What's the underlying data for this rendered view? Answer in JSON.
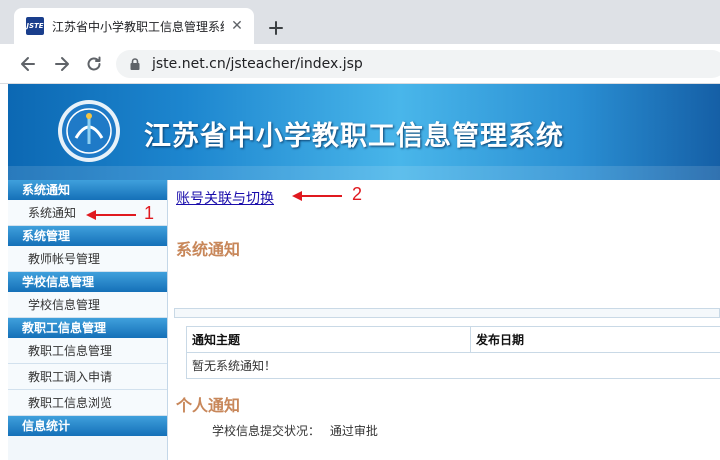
{
  "browser": {
    "tab_title": "江苏省中小学教职工信息管理系统",
    "tab_favicon_text": "JSTE",
    "url": "jste.net.cn/jsteacher/index.jsp"
  },
  "banner": {
    "title": "江苏省中小学教职工信息管理系统"
  },
  "sidebar": {
    "sections": [
      {
        "header": "系统通知",
        "items": [
          "系统通知"
        ]
      },
      {
        "header": "系统管理",
        "items": [
          "教师帐号管理"
        ]
      },
      {
        "header": "学校信息管理",
        "items": [
          "学校信息管理"
        ]
      },
      {
        "header": "教职工信息管理",
        "items": [
          "教职工信息管理",
          "教职工调入申请",
          "教职工信息浏览"
        ]
      },
      {
        "header": "信息统计",
        "items": []
      }
    ]
  },
  "content": {
    "switch_link": "账号关联与切换",
    "system_notice_title": "系统通知",
    "table_headers": [
      "通知主题",
      "发布日期"
    ],
    "empty_message": "暂无系统通知！",
    "personal_notice_title": "个人通知",
    "status_label": "学校信息提交状况：",
    "status_value": "通过审批"
  },
  "annotations": {
    "label_1": "1",
    "label_2": "2",
    "color": "#e0191f"
  }
}
